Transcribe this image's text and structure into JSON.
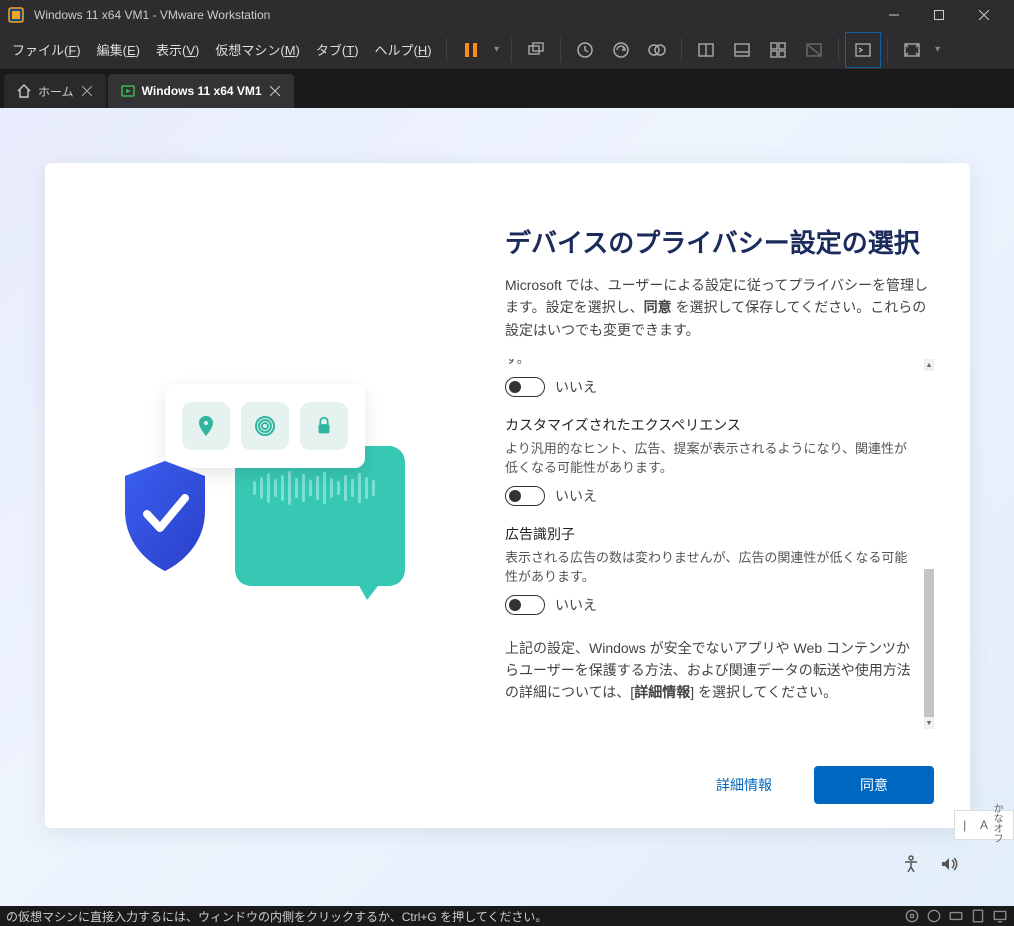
{
  "titlebar": {
    "title": "Windows 11 x64 VM1 - VMware Workstation"
  },
  "menu": {
    "file": "ファイル(F)",
    "edit": "編集(E)",
    "view": "表示(V)",
    "vm": "仮想マシン(M)",
    "tabs": "タブ(T)",
    "help": "ヘルプ(H)"
  },
  "tabs": {
    "home": "ホーム",
    "vm1": "Windows 11 x64 VM1"
  },
  "privacy": {
    "heading": "デバイスのプライバシー設定の選択",
    "intro_pre": "Microsoft では、ユーザーによる設定に従ってプライバシーを管理します。設定を選択し、",
    "intro_bold": "同意",
    "intro_post": " を選択して保存してください。これらの設定はいつでも変更できます。",
    "trunc": "す。",
    "toggle0_label": "いいえ",
    "section1_title": "カスタマイズされたエクスペリエンス",
    "section1_desc": "より汎用的なヒント、広告、提案が表示されるようになり、関連性が低くなる可能性があります。",
    "toggle1_label": "いいえ",
    "section2_title": "広告識別子",
    "section2_desc": "表示される広告の数は変わりませんが、広告の関連性が低くなる可能性があります。",
    "toggle2_label": "いいえ",
    "footer_pre": "上記の設定、Windows が安全でないアプリや Web コンテンツからユーザーを保護する方法、および関連データの転送や使用方法の詳細については、[",
    "footer_bold": "詳細情報",
    "footer_post": "] を選択してください。",
    "btn_more": "詳細情報",
    "btn_agree": "同意"
  },
  "ime": {
    "cursor": "|",
    "mode": "A",
    "kana": "かな",
    "off": "オフ"
  },
  "statusbar": {
    "msg": "の仮想マシンに直接入力するには、ウィンドウの内側をクリックするか、Ctrl+G を押してください。"
  }
}
